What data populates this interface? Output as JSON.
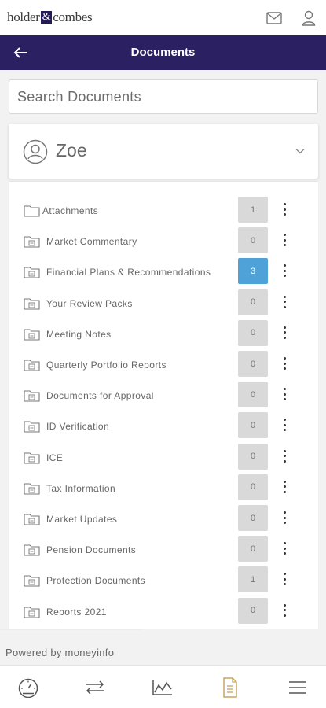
{
  "topbar": {
    "logo_left": "holder",
    "logo_amp": "&",
    "logo_right": "combes",
    "mail_icon": "mail-icon",
    "user_icon": "user-icon"
  },
  "header": {
    "title": "Documents",
    "back_icon": "arrow-left-icon",
    "color": "#2a2062"
  },
  "search": {
    "placeholder": "Search Documents",
    "value": ""
  },
  "client": {
    "name": "Zoe",
    "avatar_icon": "user-circle-icon",
    "expand_icon": "chevron-down-icon"
  },
  "folders": [
    {
      "label": "Attachments",
      "count": "1",
      "icon": "folder-icon"
    },
    {
      "label": "Market Commentary",
      "count": "0",
      "icon": "folder-doc-icon"
    },
    {
      "label": "Financial Plans & Recommendations",
      "count": "3",
      "icon": "folder-doc-icon",
      "highlighted": true
    },
    {
      "label": "Your Review Packs",
      "count": "0",
      "icon": "folder-doc-icon"
    },
    {
      "label": "Meeting Notes",
      "count": "0",
      "icon": "folder-doc-icon"
    },
    {
      "label": "Quarterly Portfolio Reports",
      "count": "0",
      "icon": "folder-doc-icon"
    },
    {
      "label": "Documents for Approval",
      "count": "0",
      "icon": "folder-doc-icon"
    },
    {
      "label": "ID Verification",
      "count": "0",
      "icon": "folder-doc-icon"
    },
    {
      "label": "ICE",
      "count": "0",
      "icon": "folder-doc-icon"
    },
    {
      "label": "Tax Information",
      "count": "0",
      "icon": "folder-doc-icon"
    },
    {
      "label": "Market Updates",
      "count": "0",
      "icon": "folder-doc-icon"
    },
    {
      "label": "Pension Documents",
      "count": "0",
      "icon": "folder-doc-icon"
    },
    {
      "label": "Protection Documents",
      "count": "1",
      "icon": "folder-doc-icon"
    },
    {
      "label": "Reports 2021",
      "count": "0",
      "icon": "folder-doc-icon"
    }
  ],
  "colors": {
    "badge_default": "#d9d9d9",
    "badge_active": "#4fa2d8",
    "documents_tab_accent": "#c8a560"
  },
  "footer": {
    "powered_by": "Powered by moneyinfo"
  },
  "bottom_nav": [
    {
      "name": "dashboard",
      "icon": "gauge-icon"
    },
    {
      "name": "transfers",
      "icon": "arrows-swap-icon"
    },
    {
      "name": "performance",
      "icon": "chart-line-icon"
    },
    {
      "name": "documents",
      "icon": "document-icon",
      "active": true
    },
    {
      "name": "menu",
      "icon": "hamburger-icon"
    }
  ]
}
